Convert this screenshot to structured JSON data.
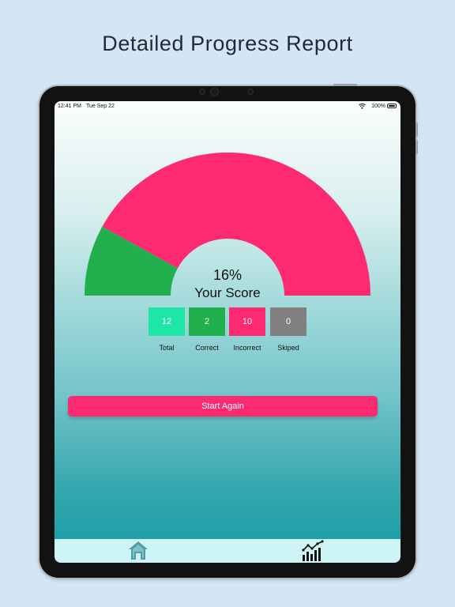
{
  "headline": "Detailed Progress Report",
  "status_bar": {
    "time": "12:41 PM",
    "date": "Tue Sep 22",
    "battery": "100%"
  },
  "score": {
    "percent": "16%",
    "label": "Your Score",
    "correct_fraction": 0.16
  },
  "stats": [
    {
      "value": "12",
      "label": "Total",
      "color": "#1ee6a6"
    },
    {
      "value": "2",
      "label": "Correct",
      "color": "#22b04e"
    },
    {
      "value": "10",
      "label": "Incorrect",
      "color": "#fd2a72"
    },
    {
      "value": "0",
      "label": "Skiped",
      "color": "#808080"
    }
  ],
  "start_button": {
    "label": "Start Again"
  },
  "tabs": [
    {
      "name": "home",
      "icon": "home-icon"
    },
    {
      "name": "progress",
      "icon": "chart-icon"
    }
  ],
  "colors": {
    "correct": "#22b04e",
    "incorrect": "#fd2a72",
    "accent": "#fd2a72"
  }
}
